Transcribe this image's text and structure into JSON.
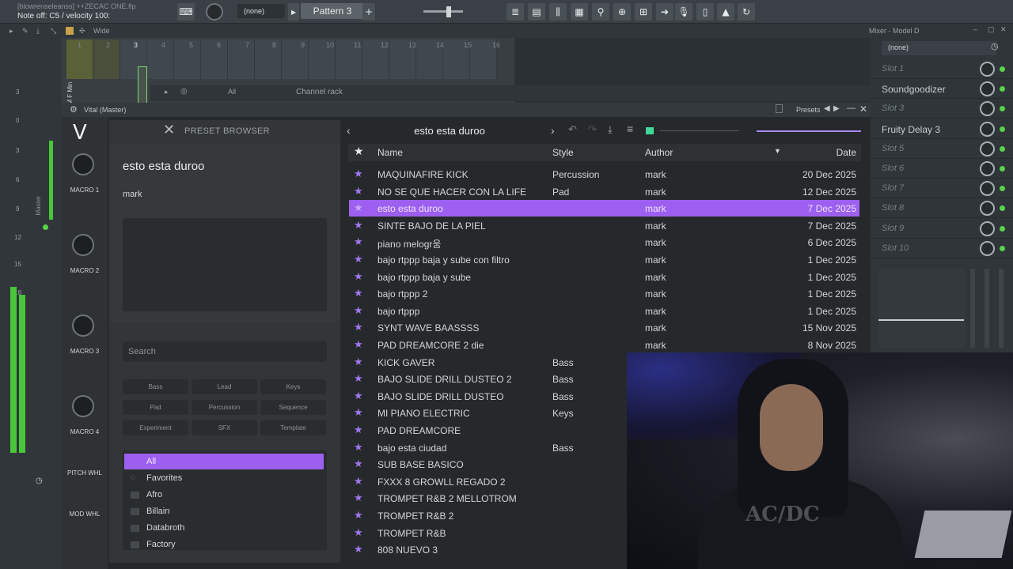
{
  "fl": {
    "file_title": "[blowrenseleanss] ++ZECAC ONE.flp",
    "status_hint": "Note off: C5 / velocity 100:",
    "snap_value": "(none)",
    "pattern_label": "Pattern 3",
    "bar2": {
      "mode_label": "Wide",
      "step": "3"
    },
    "rack": {
      "numbers": [
        "1",
        "2",
        "3",
        "4",
        "5",
        "6",
        "7",
        "8",
        "9",
        "10",
        "11",
        "12",
        "13",
        "14",
        "15",
        "16"
      ],
      "channel_label": "PM F Min",
      "filter": "All",
      "title": "Channel rack"
    },
    "left_strip": {
      "numbers": [
        "3",
        "0",
        "3",
        "6",
        "9",
        "12",
        "15",
        "18"
      ],
      "master_label": "Master"
    }
  },
  "mixer": {
    "title": "Mixer - Model D",
    "preset": "(none)",
    "slots": [
      {
        "label": "Slot 1",
        "used": false
      },
      {
        "label": "Soundgoodizer",
        "used": true
      },
      {
        "label": "Slot 3",
        "used": false
      },
      {
        "label": "Fruity Delay 3",
        "used": true
      },
      {
        "label": "Slot 5",
        "used": false
      },
      {
        "label": "Slot 6",
        "used": false
      },
      {
        "label": "Slot 7",
        "used": false
      },
      {
        "label": "Slot 8",
        "used": false
      },
      {
        "label": "Slot 9",
        "used": false
      },
      {
        "label": "Slot 10",
        "used": false
      }
    ]
  },
  "vital": {
    "window_title": "Vital (Master)",
    "presets_label": "Presets",
    "macros": [
      "MACRO 1",
      "MACRO 2",
      "MACRO 3",
      "MACRO 4"
    ],
    "wheels": [
      "PITCH WHL",
      "MOD WHL"
    ],
    "browser": {
      "title": "PRESET BROWSER",
      "preset_name": "esto esta duroo",
      "preset_author": "mark",
      "search_placeholder": "Search",
      "tags": [
        "Bass",
        "Lead",
        "Keys",
        "Pad",
        "Percussion",
        "Sequence",
        "Experiment",
        "SFX",
        "Template"
      ],
      "folders": [
        {
          "label": "All",
          "selected": true
        },
        {
          "label": "Favorites",
          "icon": "star-icon"
        },
        {
          "label": "Afro",
          "icon": "folder-icon"
        },
        {
          "label": "Billain",
          "icon": "folder-icon"
        },
        {
          "label": "Databroth",
          "icon": "folder-icon"
        },
        {
          "label": "Factory",
          "icon": "folder-icon"
        }
      ],
      "nav_name": "esto esta duroo",
      "columns": {
        "name": "Name",
        "style": "Style",
        "author": "Author",
        "date": "Date"
      },
      "rows": [
        {
          "name": "MAQUINAFIRE KICK",
          "style": "Percussion",
          "author": "mark",
          "date": "20 Dec 2025"
        },
        {
          "name": "NO SE QUE HACER CON LA LIFE",
          "style": "Pad",
          "author": "mark",
          "date": "12 Dec 2025"
        },
        {
          "name": "esto esta duroo",
          "style": "",
          "author": "mark",
          "date": "7 Dec 2025",
          "selected": true
        },
        {
          "name": "SINTE BAJO DE LA PIEL",
          "style": "",
          "author": "mark",
          "date": "7 Dec 2025"
        },
        {
          "name": "piano melogr움",
          "style": "",
          "author": "mark",
          "date": "6 Dec 2025"
        },
        {
          "name": "bajo rtppp  baja y sube con filtro",
          "style": "",
          "author": "mark",
          "date": "1 Dec 2025"
        },
        {
          "name": "bajo rtppp  baja y sube",
          "style": "",
          "author": "mark",
          "date": "1 Dec 2025"
        },
        {
          "name": "bajo rtppp 2",
          "style": "",
          "author": "mark",
          "date": "1 Dec 2025"
        },
        {
          "name": "bajo rtppp",
          "style": "",
          "author": "mark",
          "date": "1 Dec 2025"
        },
        {
          "name": "SYNT WAVE BAASSSS",
          "style": "",
          "author": "mark",
          "date": "15 Nov 2025"
        },
        {
          "name": "PAD DREAMCORE 2 die",
          "style": "",
          "author": "mark",
          "date": "8 Nov 2025"
        },
        {
          "name": "KICK GAVER",
          "style": "Bass",
          "author": "",
          "date": ""
        },
        {
          "name": "BAJO SLIDE DRILL  DUSTEO 2",
          "style": "Bass",
          "author": "",
          "date": ""
        },
        {
          "name": "BAJO SLIDE DRILL  DUSTEO",
          "style": "Bass",
          "author": "",
          "date": ""
        },
        {
          "name": "MI PIANO ELECTRIC",
          "style": "Keys",
          "author": "",
          "date": ""
        },
        {
          "name": "PAD DREAMCORE",
          "style": "",
          "author": "",
          "date": ""
        },
        {
          "name": "bajo esta ciudad",
          "style": "Bass",
          "author": "",
          "date": ""
        },
        {
          "name": "SUB BASE BASICO",
          "style": "",
          "author": "",
          "date": ""
        },
        {
          "name": "FXXX 8 GROWLL REGADO 2",
          "style": "",
          "author": "",
          "date": ""
        },
        {
          "name": "TROMPET R&B 2 MELLOTROM",
          "style": "",
          "author": "",
          "date": ""
        },
        {
          "name": "TROMPET R&B 2",
          "style": "",
          "author": "",
          "date": ""
        },
        {
          "name": "TROMPET R&B",
          "style": "",
          "author": "",
          "date": ""
        },
        {
          "name": "808   NUEVO 3",
          "style": "",
          "author": "",
          "date": ""
        }
      ]
    }
  },
  "webcam": {
    "shirt_text": "AC/DC"
  },
  "colors": {
    "accent": "#9d5ff0",
    "led": "#59d34a"
  }
}
